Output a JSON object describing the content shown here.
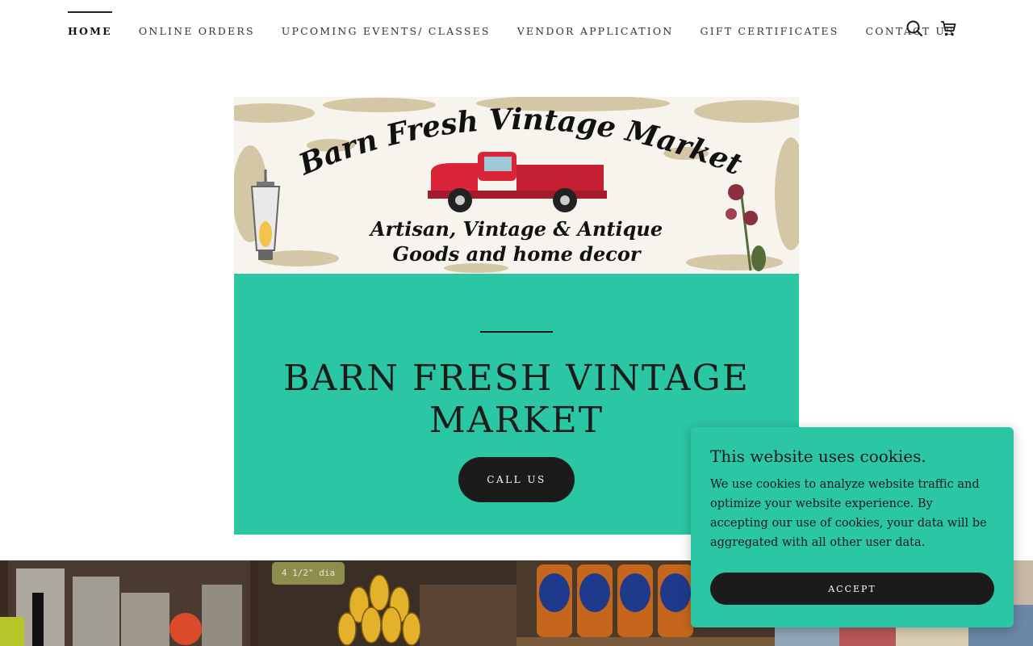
{
  "nav": {
    "items": [
      {
        "label": "HOME",
        "active": true
      },
      {
        "label": "ONLINE ORDERS"
      },
      {
        "label": "UPCOMING EVENTS/ CLASSES"
      },
      {
        "label": "VENDOR APPLICATION"
      },
      {
        "label": "GIFT CERTIFICATES"
      },
      {
        "label": "CONTACT US"
      }
    ],
    "icons": [
      "search-icon",
      "cart-icon"
    ]
  },
  "banner": {
    "headline": "Barn Fresh Vintage Market",
    "subline1": "Artisan, Vintage & Antique",
    "subline2": "Goods and home decor"
  },
  "hero": {
    "title": "BARN FRESH VINTAGE MARKET",
    "button_label": "CALL US",
    "background": "#2bc6a4"
  },
  "gallery": {
    "tiles": [
      {
        "icon": "glassware-photo"
      },
      {
        "icon": "brass-ornament-photo",
        "tag": "4 1/2\" dia"
      },
      {
        "icon": "honey-jars-photo"
      },
      {
        "icon": "fabric-photo"
      }
    ]
  },
  "cookie": {
    "title": "This website uses cookies.",
    "body": "We use cookies to analyze website traffic and optimize your website experience. By accepting our use of cookies, your data will be aggregated with all other user data.",
    "accept_label": "ACCEPT"
  },
  "colors": {
    "accent": "#2bc6a4",
    "dark": "#1b1b1b",
    "truck": "#d9243a"
  }
}
